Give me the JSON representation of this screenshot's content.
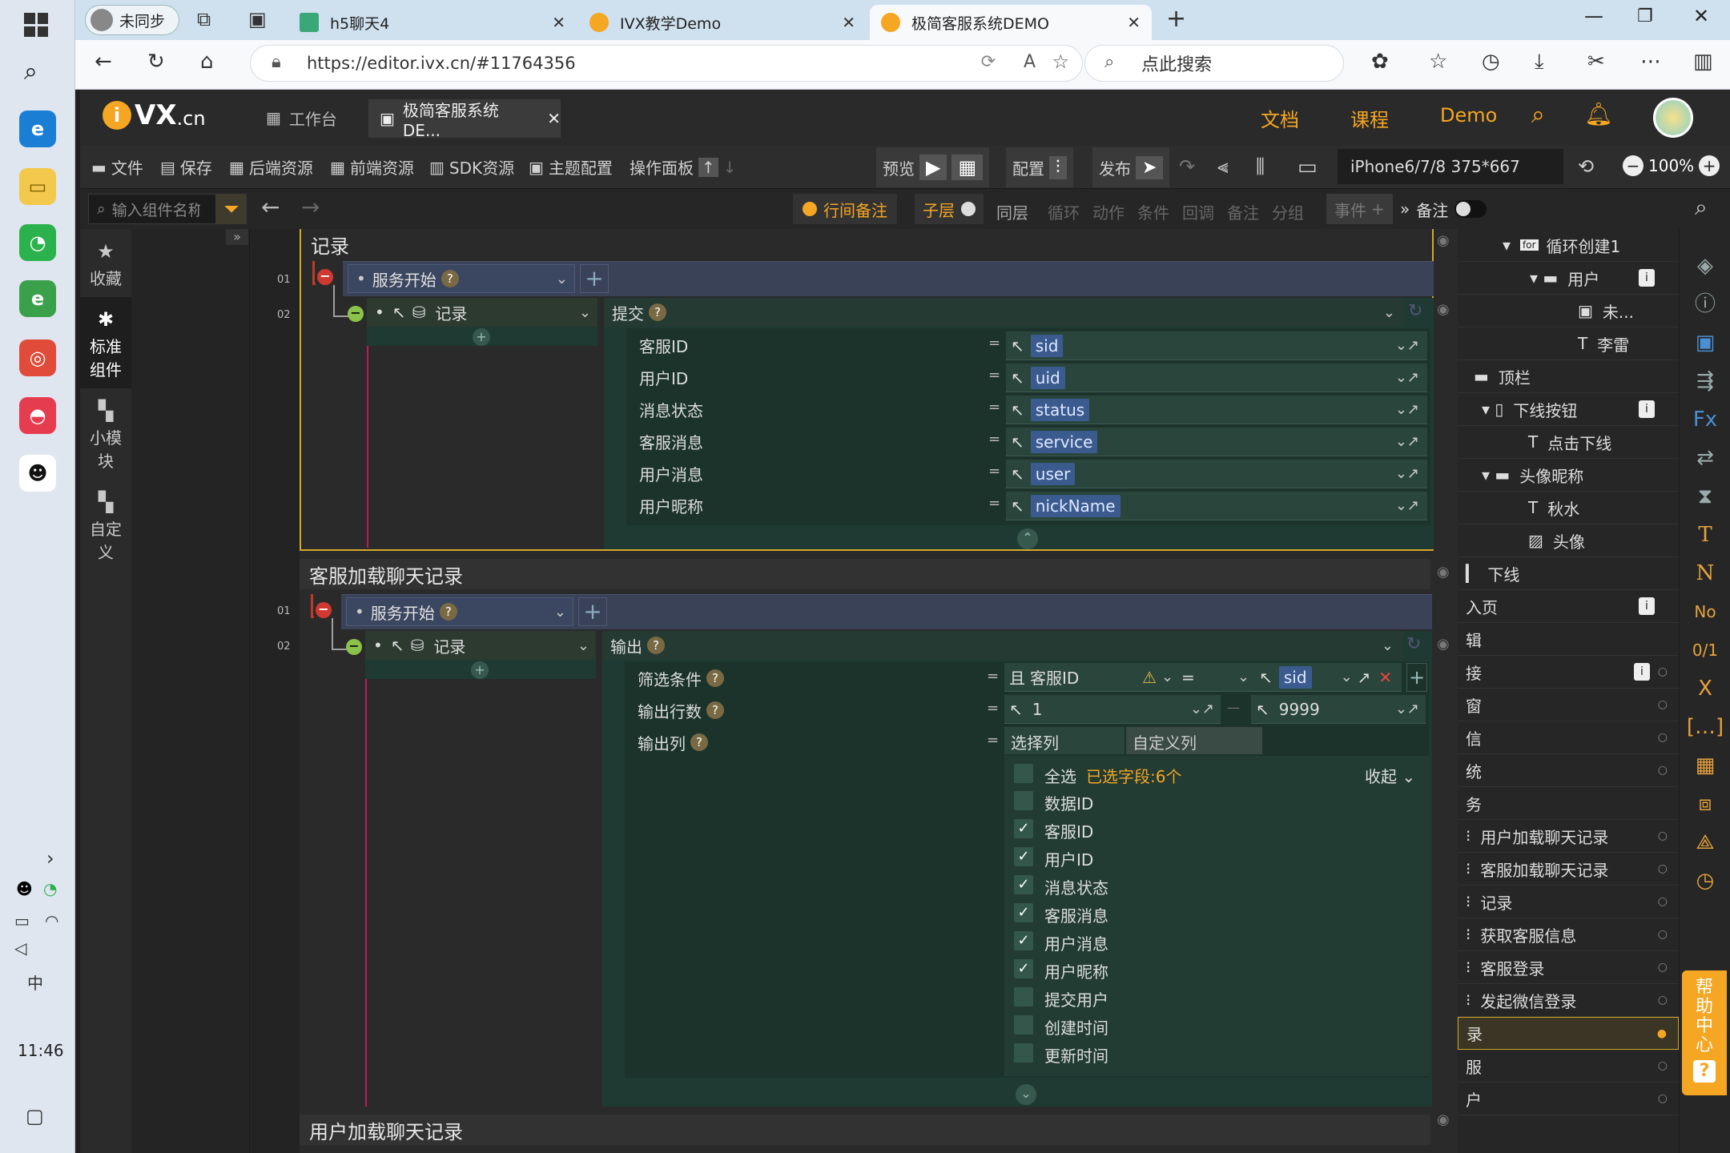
{
  "taskbar": {
    "time": "11:46",
    "ime": "中"
  },
  "browser": {
    "profile": "未同步",
    "tabs": [
      {
        "label": "h5聊天4"
      },
      {
        "label": "IVX教学Demo"
      },
      {
        "label": "极简客服系统DEMO"
      }
    ],
    "url": "https://editor.ivx.cn/#11764356",
    "search_placeholder": "点此搜索"
  },
  "ivx": {
    "logo": "VX",
    "logo_suffix": ".cn",
    "tabs": [
      {
        "label": "工作台"
      },
      {
        "label": "极简客服系统DE..."
      }
    ],
    "links": {
      "docs": "文档",
      "courses": "课程",
      "demo": "Demo"
    }
  },
  "toolbar": {
    "file": "文件",
    "save": "保存",
    "backend": "后端资源",
    "frontend": "前端资源",
    "sdk": "SDK资源",
    "theme": "主题配置",
    "ops": "操作面板",
    "preview": "预览",
    "config": "配置",
    "publish": "发布",
    "device": "iPhone6/7/8 375*667",
    "zoom": "100%"
  },
  "subbar": {
    "search_placeholder": "输入组件名称",
    "line_note": "行间备注",
    "child": "子层",
    "sibling": "同层",
    "loop": "循环",
    "action": "动作",
    "cond": "条件",
    "callback": "回调",
    "note": "备注",
    "group": "分组",
    "event": "事件",
    "remark": "备注"
  },
  "leftnav": {
    "fav": "收藏",
    "std": "标准组件",
    "mini": "小模块",
    "custom": "自定义"
  },
  "blocks": {
    "b1": {
      "title": "记录",
      "trigger": "服务开始",
      "action": "记录",
      "op": "提交",
      "fields": [
        {
          "label": "客服ID",
          "value": "sid"
        },
        {
          "label": "用户ID",
          "value": "uid"
        },
        {
          "label": "消息状态",
          "value": "status"
        },
        {
          "label": "客服消息",
          "value": "service"
        },
        {
          "label": "用户消息",
          "value": "user"
        },
        {
          "label": "用户昵称",
          "value": "nickName"
        }
      ]
    },
    "b2": {
      "title": "客服加载聊天记录",
      "trigger": "服务开始",
      "action": "记录",
      "op": "输出",
      "filter_label": "筛选条件",
      "filter_and": "且",
      "filter_field": "客服ID",
      "filter_op": "=",
      "filter_val": "sid",
      "rows_label": "输出行数",
      "rows_from": "1",
      "rows_to": "9999",
      "cols_label": "输出列",
      "tab_select": "选择列",
      "tab_custom": "自定义列",
      "select_all": "全选",
      "selected_info": "已选字段:6个",
      "collapse": "收起",
      "columns": [
        {
          "label": "数据ID",
          "checked": false
        },
        {
          "label": "客服ID",
          "checked": true
        },
        {
          "label": "用户ID",
          "checked": true
        },
        {
          "label": "消息状态",
          "checked": true
        },
        {
          "label": "客服消息",
          "checked": true
        },
        {
          "label": "用户消息",
          "checked": true
        },
        {
          "label": "用户昵称",
          "checked": true
        },
        {
          "label": "提交用户",
          "checked": false
        },
        {
          "label": "创建时间",
          "checked": false
        },
        {
          "label": "更新时间",
          "checked": false
        }
      ]
    },
    "b3": {
      "title": "用户加载聊天记录"
    }
  },
  "tree": [
    {
      "label": "循环创建1",
      "tag": "for"
    },
    {
      "label": "用户"
    },
    {
      "label": "未..."
    },
    {
      "label": "李雷"
    },
    {
      "label": "顶栏"
    },
    {
      "label": "下线按钮"
    },
    {
      "label": "点击下线"
    },
    {
      "label": "头像昵称"
    },
    {
      "label": "秋水"
    },
    {
      "label": "头像"
    },
    {
      "label": "下线"
    },
    {
      "label": "入页"
    },
    {
      "label": "辑"
    },
    {
      "label": "接"
    },
    {
      "label": "窗"
    },
    {
      "label": "信"
    },
    {
      "label": "统"
    },
    {
      "label": "务"
    },
    {
      "label": "用户加载聊天记录"
    },
    {
      "label": "客服加载聊天记录"
    },
    {
      "label": "记录"
    },
    {
      "label": "获取客服信息"
    },
    {
      "label": "客服登录"
    },
    {
      "label": "发起微信登录"
    },
    {
      "label": "录"
    },
    {
      "label": "服"
    },
    {
      "label": "户"
    }
  ],
  "help": "帮助中心",
  "rail_icons": {
    "t": "T",
    "n": "N",
    "no": "No",
    "frac": "0/1",
    "x": "X",
    "fx": "Fx"
  },
  "row_nums": {
    "r1": "01",
    "r2": "02"
  },
  "qmark": "?",
  "colors": {
    "accent": "#f5a623",
    "gold_border": "#d4a72c",
    "event_bar": "#3a4258",
    "action_green": "#1f3a32"
  }
}
